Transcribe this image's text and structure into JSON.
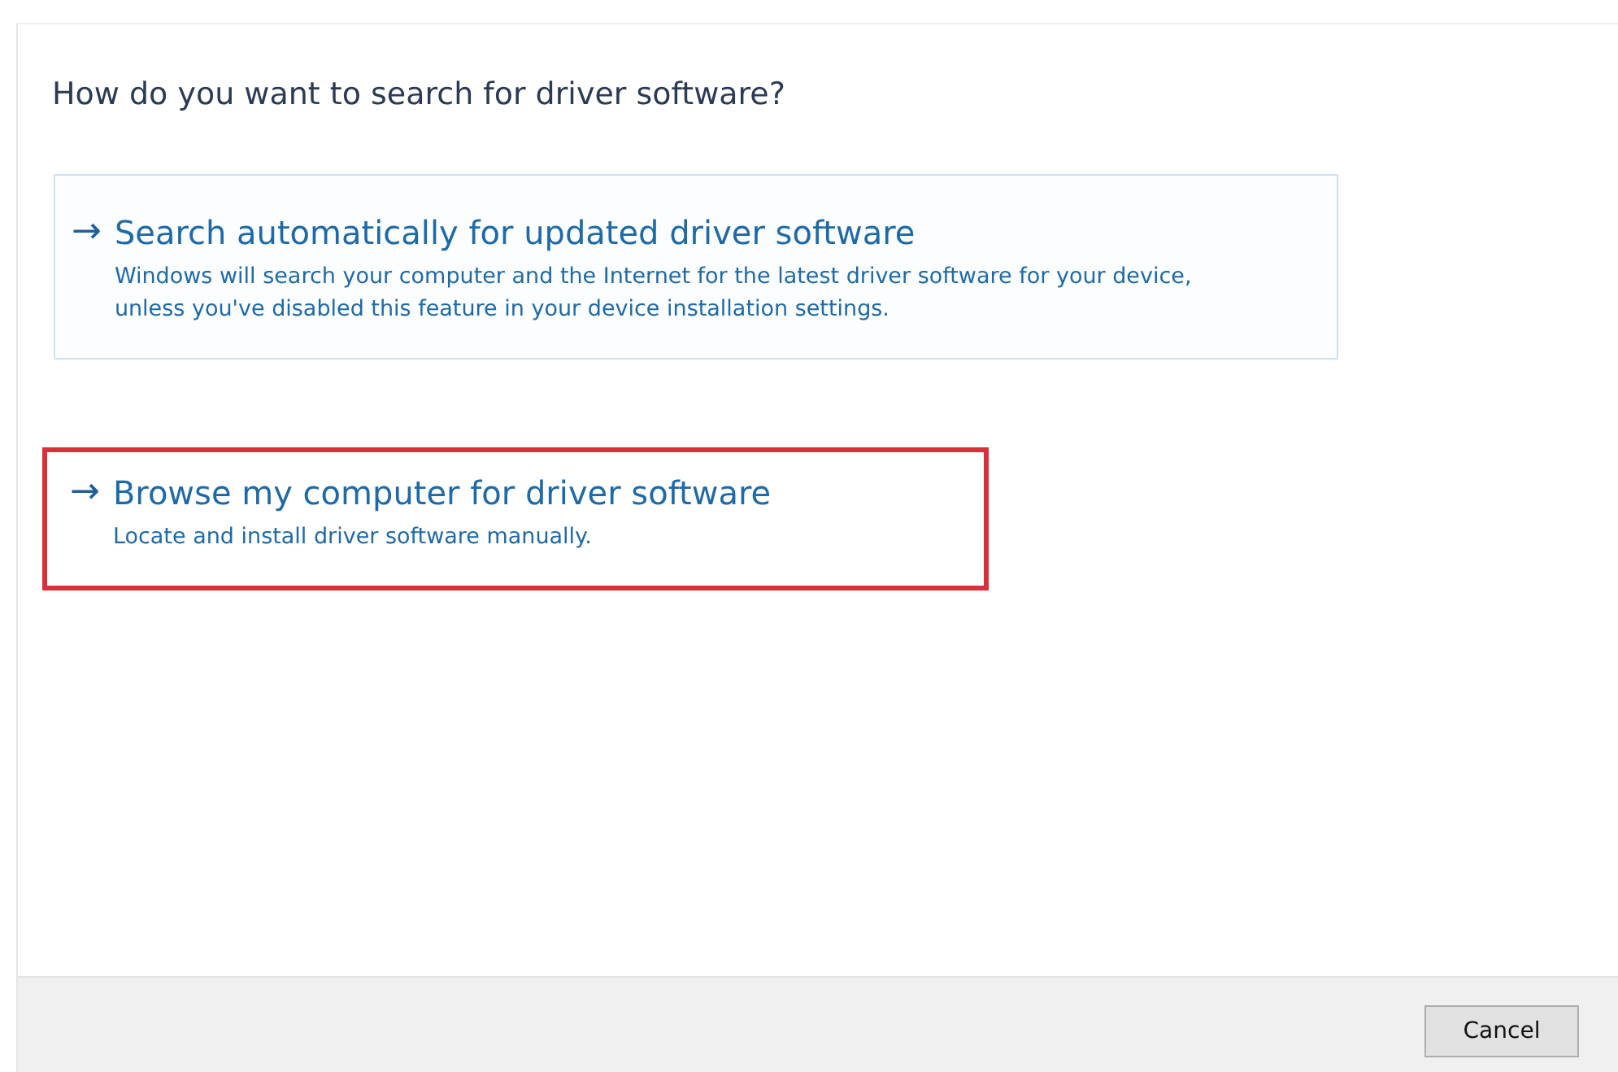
{
  "heading": "How do you want to search for driver software?",
  "options": [
    {
      "arrow": "→",
      "title": "Search automatically for updated driver software",
      "description": "Windows will search your computer and the Internet for the latest driver software for your device, unless you've disabled this feature in your device installation settings.",
      "focused": true,
      "highlighted": false
    },
    {
      "arrow": "→",
      "title": "Browse my computer for driver software",
      "description": "Locate and install driver software manually.",
      "focused": false,
      "highlighted": true
    }
  ],
  "buttons": [
    "Cancel"
  ]
}
